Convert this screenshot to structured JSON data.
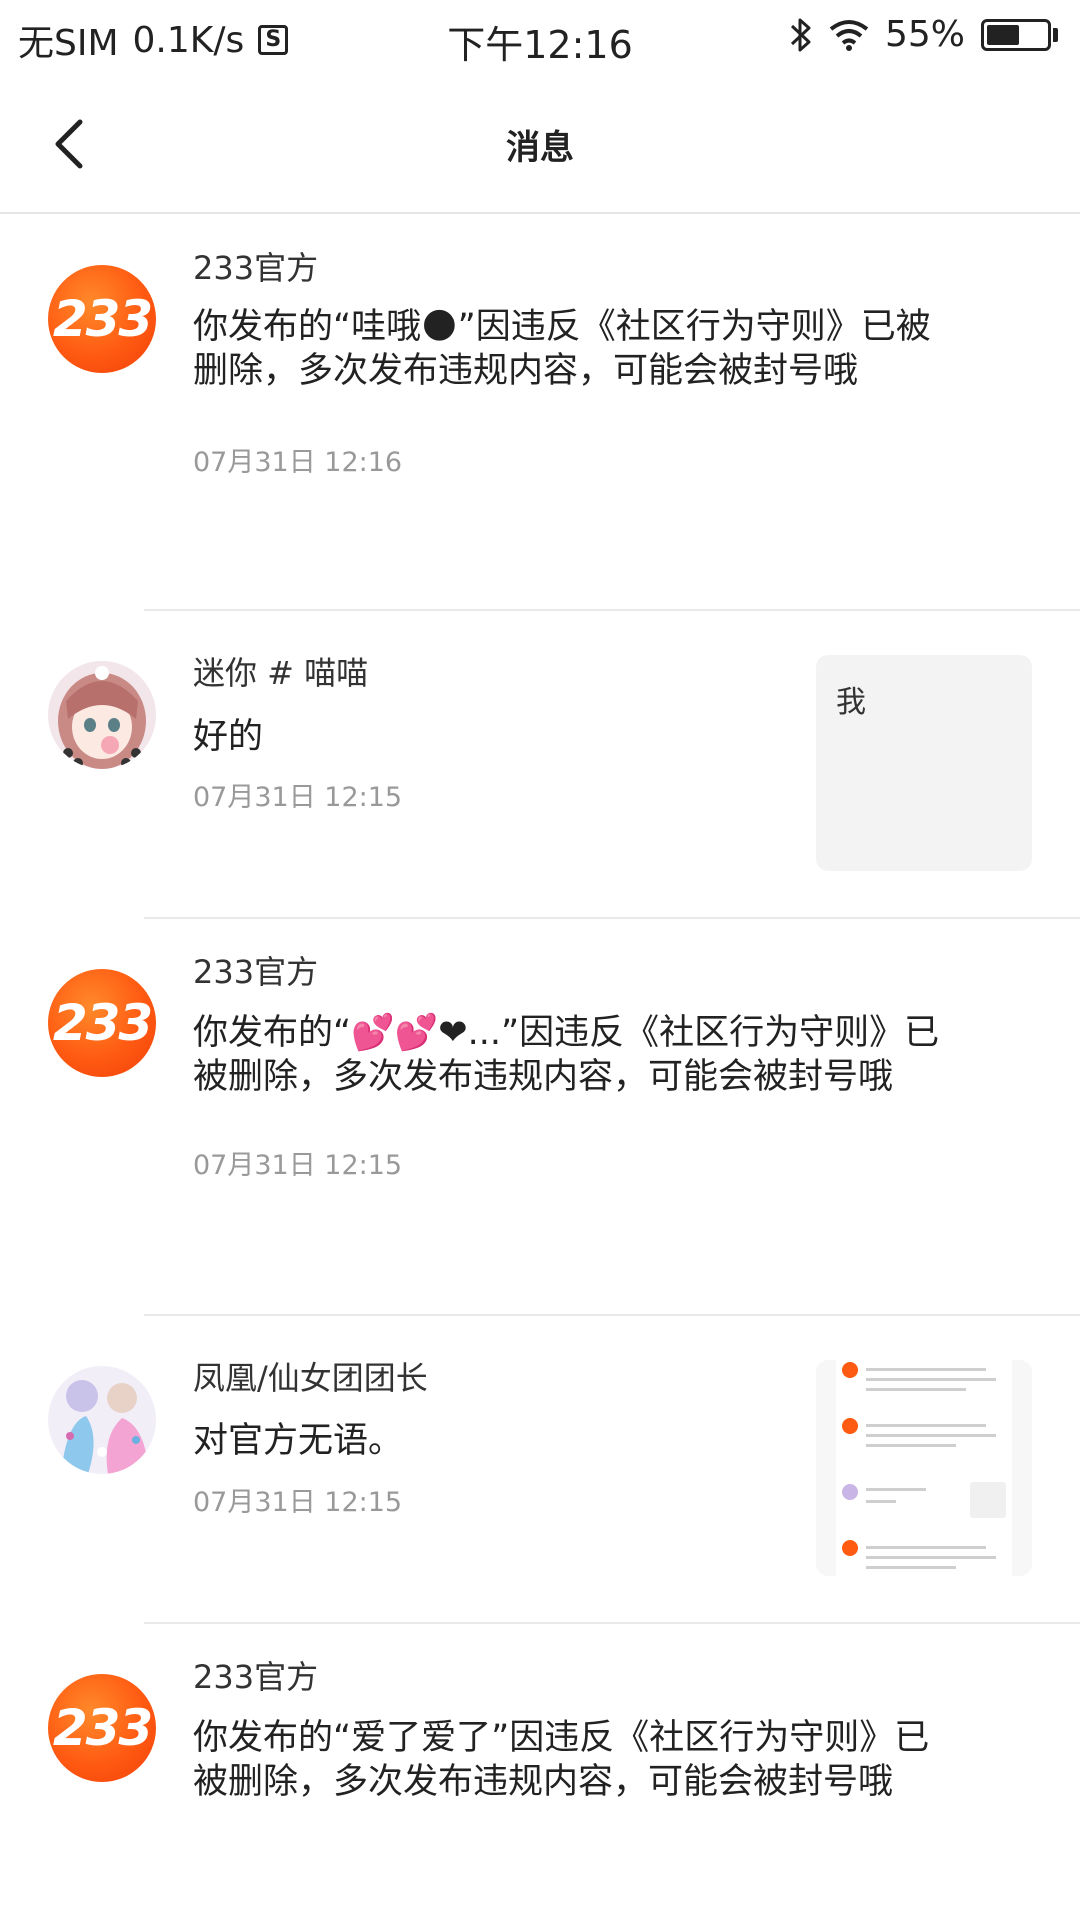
{
  "status_bar": {
    "carrier": "无SIM",
    "speed": "0.1K/s",
    "sim_icon": "S",
    "time": "下午12:16",
    "battery": "55%",
    "battery_level": 0.55
  },
  "header": {
    "title": "消息",
    "back_icon": "chevron-left-icon"
  },
  "messages": [
    {
      "sender": "233官方",
      "avatar_text": "233",
      "text": "你发布的“哇哦🌑”因违反《社区行为守则》已被删除，多次发布违规内容，可能会被封号哦",
      "time": "07月31日 12:16"
    },
    {
      "sender": "迷你 # 喵喵",
      "text": "好的",
      "time": "07月31日 12:15",
      "thumb_text": "我"
    },
    {
      "sender": "233官方",
      "avatar_text": "233",
      "text": "你发布的“💕💕❤...”因违反《社区行为守则》已被删除，多次发布违规内容，可能会被封号哦",
      "time": "07月31日 12:15"
    },
    {
      "sender": "凤凰/仙女团团长",
      "text": "对官方无语。",
      "time": "07月31日 12:15"
    },
    {
      "sender": "233官方",
      "avatar_text": "233",
      "text": "你发布的“爱了爱了”因违反《社区行为守则》已被删除，多次发布违规内容，可能会被封号哦"
    }
  ],
  "colors": {
    "brand_orange": "#ff5a12",
    "divider": "#e9e9e9",
    "time_gray": "#999999"
  }
}
